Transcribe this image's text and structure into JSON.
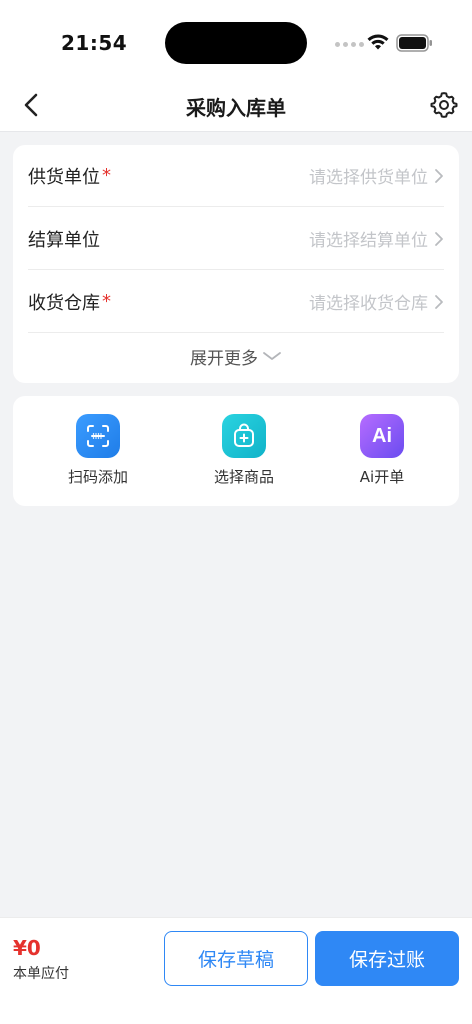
{
  "status_bar": {
    "time": "21:54"
  },
  "nav": {
    "title": "采购入库单"
  },
  "form": {
    "rows": [
      {
        "label": "供货单位",
        "required": true,
        "placeholder": "请选择供货单位"
      },
      {
        "label": "结算单位",
        "required": false,
        "placeholder": "请选择结算单位"
      },
      {
        "label": "收货仓库",
        "required": true,
        "placeholder": "请选择收货仓库"
      }
    ],
    "required_mark": "*",
    "expand_label": "展开更多"
  },
  "actions": [
    {
      "label": "扫码添加",
      "icon": "scan-icon"
    },
    {
      "label": "选择商品",
      "icon": "shopping-bag-icon"
    },
    {
      "label": "Ai开单",
      "icon": "ai-icon",
      "icon_text": "Ai"
    }
  ],
  "bottom": {
    "amount": "¥0",
    "amount_label": "本单应付",
    "draft_button": "保存草稿",
    "post_button": "保存过账"
  },
  "colors": {
    "primary": "#2f88f5",
    "required": "#e5322d",
    "background": "#f2f3f5"
  }
}
